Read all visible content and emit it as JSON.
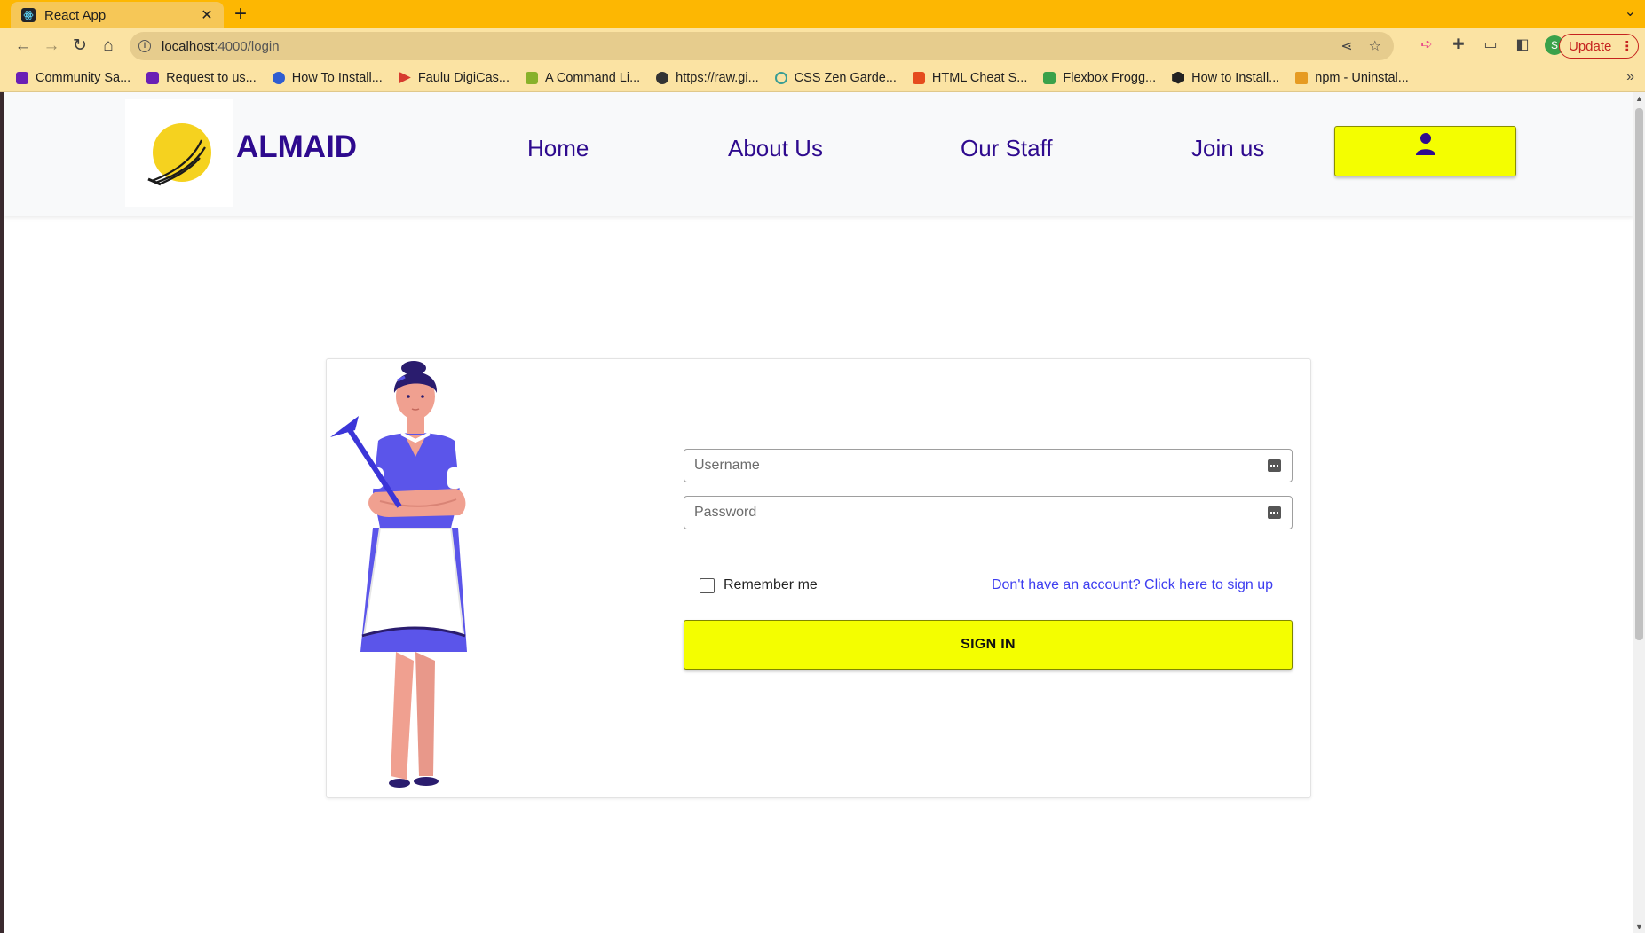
{
  "browser": {
    "tab_title": "React App",
    "url_host": "localhost",
    "url_rest": ":4000/login",
    "update_label": "Update",
    "bookmarks": [
      {
        "label": "Community Sa...",
        "color": "#6a1fb5"
      },
      {
        "label": "Request to us...",
        "color": "#6a1fb5"
      },
      {
        "label": "How To Install...",
        "color": "#2f5dd1"
      },
      {
        "label": "Faulu DigiCas...",
        "color": "#d63b2e"
      },
      {
        "label": "A Command Li...",
        "color": "#88b12a"
      },
      {
        "label": "https://raw.gi...",
        "color": "#333333"
      },
      {
        "label": "CSS Zen Garde...",
        "color": "#3a9d94"
      },
      {
        "label": "HTML Cheat S...",
        "color": "#e54b1d"
      },
      {
        "label": "Flexbox Frogg...",
        "color": "#3aa14a"
      },
      {
        "label": "How to Install...",
        "color": "#222222"
      },
      {
        "label": "npm - Uninstal...",
        "color": "#e69b22"
      }
    ]
  },
  "navbar": {
    "brand": "ALMAID",
    "links": [
      "Home",
      "About Us",
      "Our Staff",
      "Join us"
    ],
    "user_icon": "user-icon"
  },
  "login": {
    "username_placeholder": "Username",
    "password_placeholder": "Password",
    "remember_label": "Remember me",
    "signup_link": "Don't have an account? Click here to sign up",
    "submit_label": "SIGN IN"
  },
  "colors": {
    "accent": "#f4fe00",
    "brand": "#2e0a8e",
    "link": "#3d3df0",
    "chrome": "#fdb702"
  }
}
